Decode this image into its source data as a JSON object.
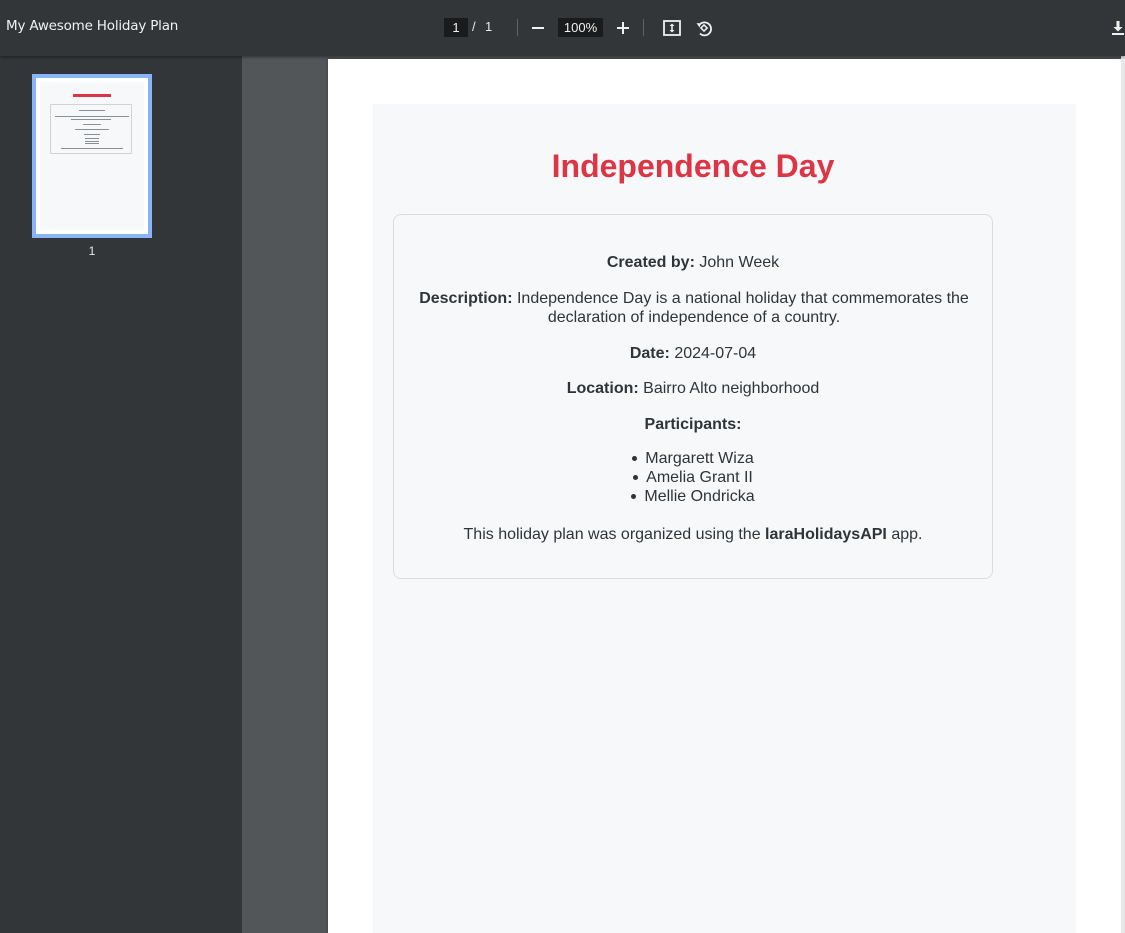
{
  "toolbar": {
    "document_title": "My Awesome Holiday Plan",
    "current_page": "1",
    "page_separator": "/",
    "total_pages": "1",
    "zoom_level": "100%",
    "icons": [
      "zoom-out-icon",
      "zoom-in-icon",
      "fit-page-icon",
      "rotate-icon",
      "download-icon"
    ]
  },
  "sidebar": {
    "thumbnails": [
      {
        "page_number": "1"
      }
    ]
  },
  "document": {
    "title": "Independence Day",
    "title_color": "#dc3545",
    "created_by_label": "Created by:",
    "created_by_value": "John Week",
    "description_label": "Description:",
    "description_value": "Independence Day is a national holiday that commemorates the declaration of independence of a country.",
    "date_label": "Date:",
    "date_value": "2024-07-04",
    "location_label": "Location:",
    "location_value": "Bairro Alto neighborhood",
    "participants_label": "Participants:",
    "participants": [
      "Margarett Wiza",
      "Amelia Grant II",
      "Mellie Ondricka"
    ],
    "footer_prefix": "This holiday plan was organized using the",
    "footer_app": "laraHolidaysAPI",
    "footer_suffix": "app."
  }
}
